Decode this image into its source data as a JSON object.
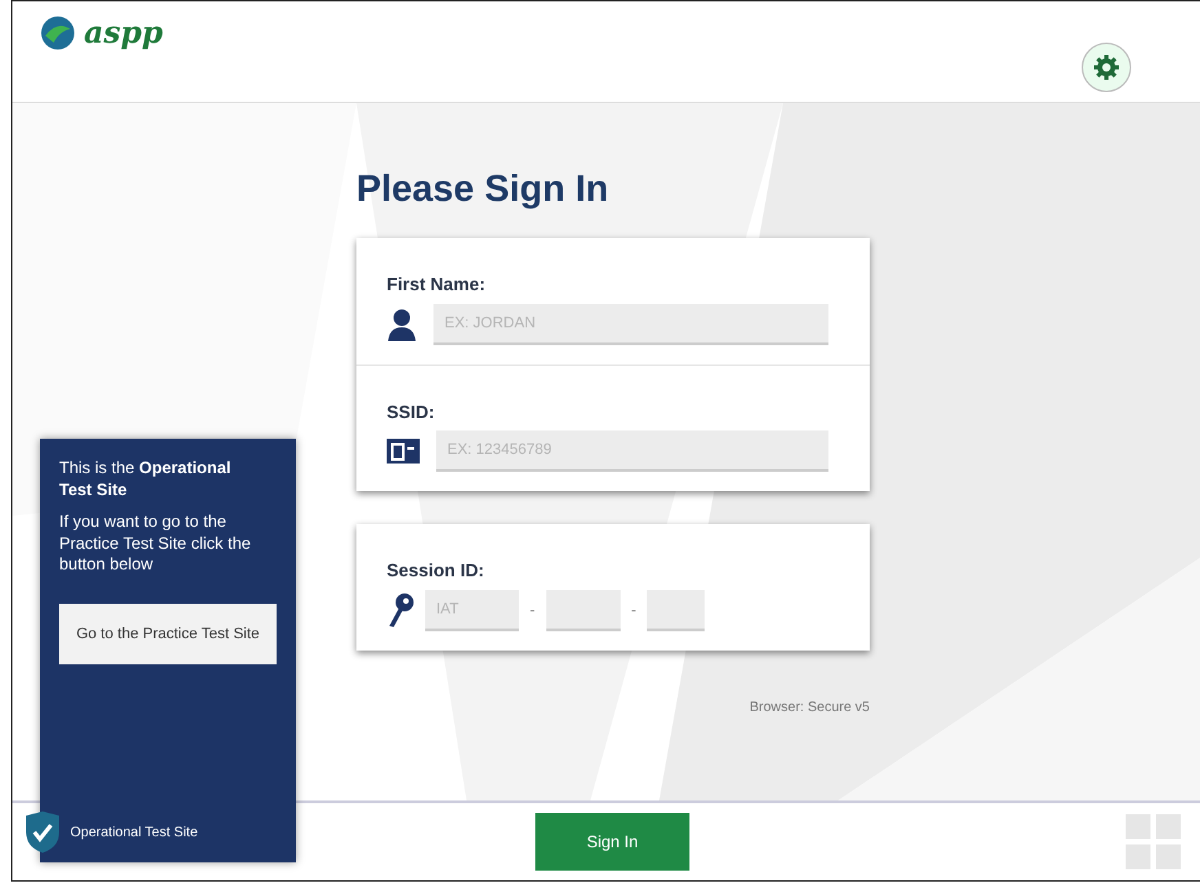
{
  "header": {
    "logo_text": "aspp"
  },
  "title": "Please Sign In",
  "identity_card": {
    "fields": [
      {
        "label": "First Name:",
        "kind": "person",
        "placeholder": "EX: JORDAN"
      },
      {
        "label": "SSID:",
        "kind": "id",
        "placeholder": "EX: 123456789"
      }
    ]
  },
  "session_card": {
    "label": "Session ID:",
    "segments": [
      {
        "kind": "input",
        "placeholder": "IAT"
      },
      {
        "kind": "separator",
        "text": "-"
      },
      {
        "kind": "input"
      },
      {
        "kind": "separator",
        "text": "-"
      },
      {
        "kind": "input"
      }
    ]
  },
  "browser_info": "Browser: Secure v5",
  "site_panel": {
    "intro": "This is the **Operational Test Site**",
    "message": "If you want to go to the Practice Test Site click the button below",
    "button": "Go to the Practice Test Site",
    "badge": "Operational Test Site"
  },
  "footer": {
    "sign_in": "Sign In"
  }
}
